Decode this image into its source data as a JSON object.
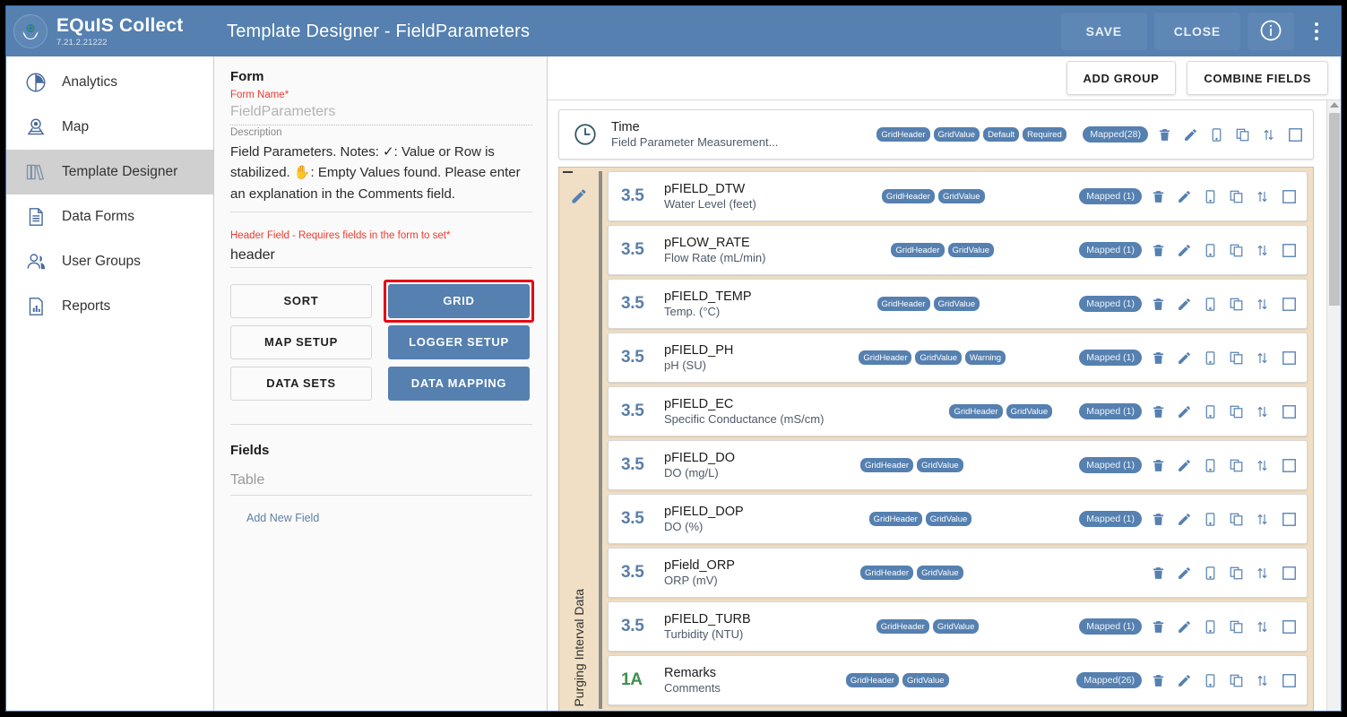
{
  "brand": {
    "name": "EQuIS Collect",
    "version": "7.21.2.21222",
    "logo_icon": "globe-hands-logo"
  },
  "header": {
    "title": "Template Designer - FieldParameters",
    "save_label": "SAVE",
    "close_label": "CLOSE",
    "info_icon": "info-circle-icon",
    "menu_icon": "kebab-menu-icon",
    "bg_color": "#5580b0"
  },
  "sidebar": {
    "items": [
      {
        "label": "Analytics",
        "icon": "pie-chart-icon",
        "active": false
      },
      {
        "label": "Map",
        "icon": "map-pin-icon",
        "active": false
      },
      {
        "label": "Template Designer",
        "icon": "books-icon",
        "active": true
      },
      {
        "label": "Data Forms",
        "icon": "document-icon",
        "active": false
      },
      {
        "label": "User Groups",
        "icon": "users-icon",
        "active": false
      },
      {
        "label": "Reports",
        "icon": "bar-chart-report-icon",
        "active": false
      }
    ]
  },
  "form_panel": {
    "heading": "Form",
    "form_name_label": "Form Name",
    "form_name_value": "FieldParameters",
    "description_label": "Description",
    "description_value": "Field Parameters. Notes: ✓: Value or Row is stabilized. ✋: Empty Values found. Please enter an explanation in the Comments field.",
    "header_field_label": "Header Field - Requires fields in the form to set",
    "header_field_value": "header",
    "required_marker": "*",
    "buttons": [
      {
        "label": "SORT",
        "style": "light",
        "highlighted": false
      },
      {
        "label": "GRID",
        "style": "blue",
        "highlighted": true
      },
      {
        "label": "MAP SETUP",
        "style": "light",
        "highlighted": false
      },
      {
        "label": "LOGGER SETUP",
        "style": "blue",
        "highlighted": false
      },
      {
        "label": "DATA SETS",
        "style": "light",
        "highlighted": false
      },
      {
        "label": "DATA MAPPING",
        "style": "blue",
        "highlighted": false
      }
    ],
    "fields_heading": "Fields",
    "table_placeholder": "Table",
    "add_new_field_label": "Add New Field",
    "highlight_color": "#e50914"
  },
  "right_panel": {
    "add_group_label": "ADD GROUP",
    "combine_fields_label": "COMBINE FIELDS",
    "row_action_icons": [
      "delete-icon",
      "edit-icon",
      "mobile-icon",
      "duplicate-icon",
      "sort-arrows-icon",
      "select-checkbox-icon"
    ],
    "standalone_row": {
      "icon": "clock-icon",
      "code": "Time",
      "description": "Field Parameter Measurement...",
      "badges": [
        "GridHeader",
        "GridValue",
        "Default",
        "Required"
      ],
      "mapped": "Mapped(28)"
    },
    "group": {
      "label": "Purging Interval Data",
      "collapse_icon": "minus-icon",
      "edit_icon": "pencil-icon",
      "bg_color": "#f0dfc4",
      "rows": [
        {
          "type": "3.5",
          "type_kind": "num",
          "code": "pFIELD_DTW",
          "description": "Water Level (feet)",
          "badges": [
            "GridHeader",
            "GridValue"
          ],
          "mapped": "Mapped (1)"
        },
        {
          "type": "3.5",
          "type_kind": "num",
          "code": "pFLOW_RATE",
          "description": "Flow Rate (mL/min)",
          "badges": [
            "GridHeader",
            "GridValue"
          ],
          "mapped": "Mapped (1)"
        },
        {
          "type": "3.5",
          "type_kind": "num",
          "code": "pFIELD_TEMP",
          "description": "Temp. (°C)",
          "badges": [
            "GridHeader",
            "GridValue"
          ],
          "mapped": "Mapped (1)"
        },
        {
          "type": "3.5",
          "type_kind": "num",
          "code": "pFIELD_PH",
          "description": "pH (SU)",
          "badges": [
            "GridHeader",
            "GridValue",
            "Warning"
          ],
          "mapped": "Mapped (1)"
        },
        {
          "type": "3.5",
          "type_kind": "num",
          "code": "pFIELD_EC",
          "description": "Specific Conductance (mS/cm)",
          "badges": [
            "GridHeader",
            "GridValue"
          ],
          "mapped": "Mapped (1)"
        },
        {
          "type": "3.5",
          "type_kind": "num",
          "code": "pFIELD_DO",
          "description": "DO (mg/L)",
          "badges": [
            "GridHeader",
            "GridValue"
          ],
          "mapped": "Mapped (1)"
        },
        {
          "type": "3.5",
          "type_kind": "num",
          "code": "pFIELD_DOP",
          "description": "DO (%)",
          "badges": [
            "GridHeader",
            "GridValue"
          ],
          "mapped": "Mapped (1)"
        },
        {
          "type": "3.5",
          "type_kind": "num",
          "code": "pField_ORP",
          "description": "ORP (mV)",
          "badges": [
            "GridHeader",
            "GridValue"
          ],
          "mapped": ""
        },
        {
          "type": "3.5",
          "type_kind": "num",
          "code": "pFIELD_TURB",
          "description": "Turbidity (NTU)",
          "badges": [
            "GridHeader",
            "GridValue"
          ],
          "mapped": "Mapped (1)"
        },
        {
          "type": "1A",
          "type_kind": "txt",
          "code": "Remarks",
          "description": "Comments",
          "badges": [
            "GridHeader",
            "GridValue"
          ],
          "mapped": "Mapped(26)"
        }
      ]
    },
    "scrollbar": {
      "icon": "scroll-up-arrow-icon"
    }
  }
}
